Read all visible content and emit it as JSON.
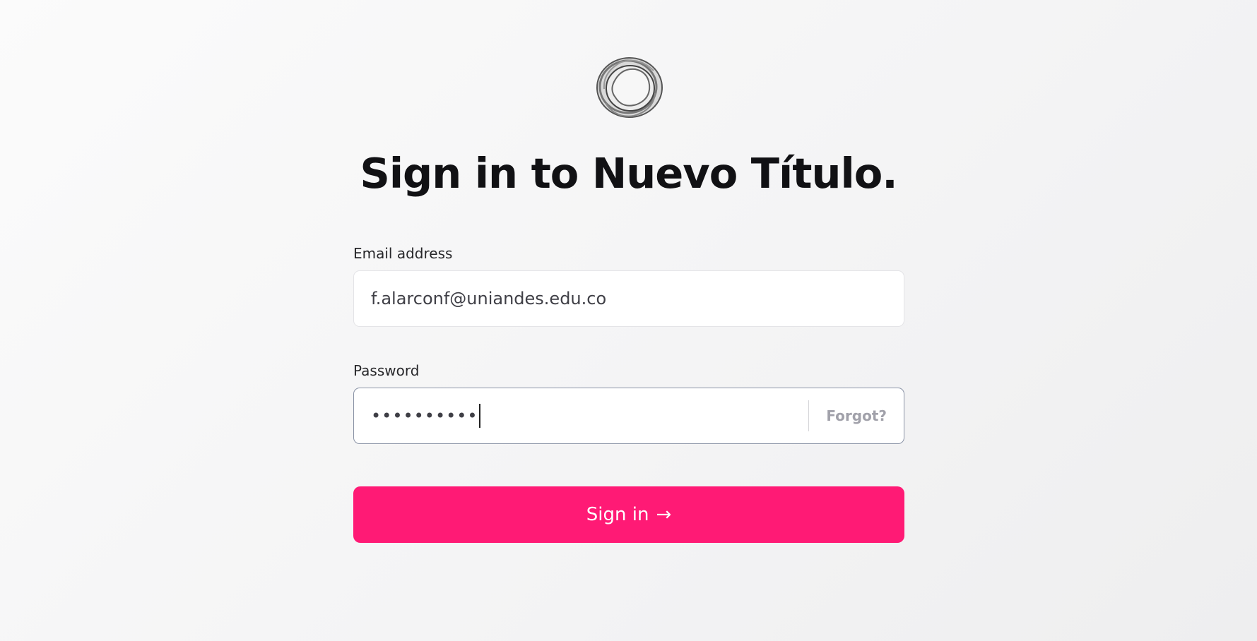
{
  "page": {
    "title": "Sign in to Nuevo Título."
  },
  "logo": {
    "icon": "abstract-ring-logo-icon"
  },
  "form": {
    "email": {
      "label": "Email address",
      "value": "f.alarconf@uniandes.edu.co"
    },
    "password": {
      "label": "Password",
      "masked_value": "••••••••••",
      "forgot_label": "Forgot?"
    },
    "submit": {
      "label": "Sign in",
      "arrow_icon": "→"
    }
  },
  "colors": {
    "accent": "#ff1a75",
    "title": "#111114",
    "muted": "#a1a1aa"
  }
}
